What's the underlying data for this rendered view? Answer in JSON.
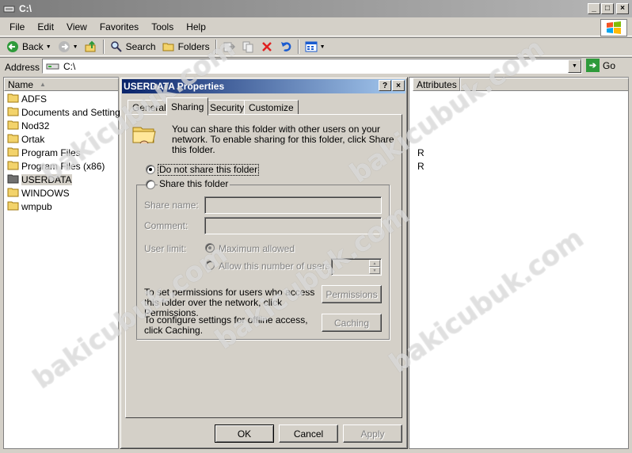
{
  "window": {
    "title": "C:\\"
  },
  "menu": [
    "File",
    "Edit",
    "View",
    "Favorites",
    "Tools",
    "Help"
  ],
  "toolbar": {
    "back": "Back",
    "search": "Search",
    "folders": "Folders"
  },
  "address": {
    "label": "Address",
    "value": "C:\\",
    "go": "Go"
  },
  "tree": {
    "header": "Name",
    "items": [
      "ADFS",
      "Documents and Settings",
      "Nod32",
      "Ortak",
      "Program Files",
      "Program Files (x86)",
      "USERDATA",
      "WINDOWS",
      "wmpub"
    ]
  },
  "list": {
    "header": "Attributes",
    "values": [
      "R",
      "R"
    ]
  },
  "dialog": {
    "title": "USERDATA Properties",
    "help": "?",
    "close": "×",
    "tabs": [
      "General",
      "Sharing",
      "Security",
      "Customize"
    ],
    "intro": "You can share this folder with other users on your network.  To enable sharing for this folder, click Share this folder.",
    "not_share": "Do not share this folder",
    "share": "Share this folder",
    "share_name_label": "Share name:",
    "comment_label": "Comment:",
    "user_limit_label": "User limit:",
    "max_allowed": "Maximum allowed",
    "allow_number": "Allow this number of users:",
    "permissions_text": "To set permissions for users who access this folder over the network, click Permissions.",
    "permissions_btn": "Permissions",
    "caching_text": "To configure settings for offline access, click Caching.",
    "caching_btn": "Caching",
    "ok": "OK",
    "cancel": "Cancel",
    "apply": "Apply"
  },
  "watermark": "bakicubuk.com"
}
